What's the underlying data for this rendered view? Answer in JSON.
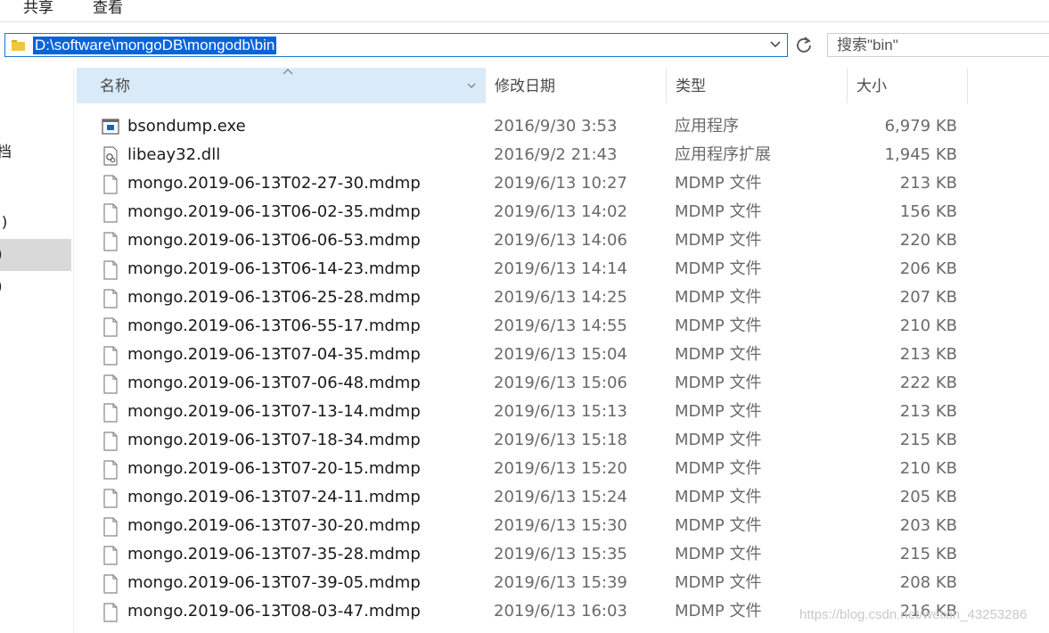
{
  "ribbon": {
    "tabs": [
      "共享",
      "查看"
    ]
  },
  "address": {
    "path": "D:\\software\\mongoDB\\mongodb\\bin",
    "search_placeholder": "搜索\"bin\""
  },
  "nav": {
    "fragments": [
      "档",
      ":)",
      ")",
      ")"
    ]
  },
  "columns": {
    "name": "名称",
    "date": "修改日期",
    "type": "类型",
    "size": "大小"
  },
  "files": [
    {
      "icon": "exe-icon",
      "name": "bsondump.exe",
      "date": "2016/9/30 3:53",
      "type": "应用程序",
      "size": "6,979 KB"
    },
    {
      "icon": "dll-icon",
      "name": "libeay32.dll",
      "date": "2016/9/2 21:43",
      "type": "应用程序扩展",
      "size": "1,945 KB"
    },
    {
      "icon": "file-icon",
      "name": "mongo.2019-06-13T02-27-30.mdmp",
      "date": "2019/6/13 10:27",
      "type": "MDMP 文件",
      "size": "213 KB"
    },
    {
      "icon": "file-icon",
      "name": "mongo.2019-06-13T06-02-35.mdmp",
      "date": "2019/6/13 14:02",
      "type": "MDMP 文件",
      "size": "156 KB"
    },
    {
      "icon": "file-icon",
      "name": "mongo.2019-06-13T06-06-53.mdmp",
      "date": "2019/6/13 14:06",
      "type": "MDMP 文件",
      "size": "220 KB"
    },
    {
      "icon": "file-icon",
      "name": "mongo.2019-06-13T06-14-23.mdmp",
      "date": "2019/6/13 14:14",
      "type": "MDMP 文件",
      "size": "206 KB"
    },
    {
      "icon": "file-icon",
      "name": "mongo.2019-06-13T06-25-28.mdmp",
      "date": "2019/6/13 14:25",
      "type": "MDMP 文件",
      "size": "207 KB"
    },
    {
      "icon": "file-icon",
      "name": "mongo.2019-06-13T06-55-17.mdmp",
      "date": "2019/6/13 14:55",
      "type": "MDMP 文件",
      "size": "210 KB"
    },
    {
      "icon": "file-icon",
      "name": "mongo.2019-06-13T07-04-35.mdmp",
      "date": "2019/6/13 15:04",
      "type": "MDMP 文件",
      "size": "213 KB"
    },
    {
      "icon": "file-icon",
      "name": "mongo.2019-06-13T07-06-48.mdmp",
      "date": "2019/6/13 15:06",
      "type": "MDMP 文件",
      "size": "222 KB"
    },
    {
      "icon": "file-icon",
      "name": "mongo.2019-06-13T07-13-14.mdmp",
      "date": "2019/6/13 15:13",
      "type": "MDMP 文件",
      "size": "213 KB"
    },
    {
      "icon": "file-icon",
      "name": "mongo.2019-06-13T07-18-34.mdmp",
      "date": "2019/6/13 15:18",
      "type": "MDMP 文件",
      "size": "215 KB"
    },
    {
      "icon": "file-icon",
      "name": "mongo.2019-06-13T07-20-15.mdmp",
      "date": "2019/6/13 15:20",
      "type": "MDMP 文件",
      "size": "210 KB"
    },
    {
      "icon": "file-icon",
      "name": "mongo.2019-06-13T07-24-11.mdmp",
      "date": "2019/6/13 15:24",
      "type": "MDMP 文件",
      "size": "205 KB"
    },
    {
      "icon": "file-icon",
      "name": "mongo.2019-06-13T07-30-20.mdmp",
      "date": "2019/6/13 15:30",
      "type": "MDMP 文件",
      "size": "203 KB"
    },
    {
      "icon": "file-icon",
      "name": "mongo.2019-06-13T07-35-28.mdmp",
      "date": "2019/6/13 15:35",
      "type": "MDMP 文件",
      "size": "215 KB"
    },
    {
      "icon": "file-icon",
      "name": "mongo.2019-06-13T07-39-05.mdmp",
      "date": "2019/6/13 15:39",
      "type": "MDMP 文件",
      "size": "208 KB"
    },
    {
      "icon": "file-icon",
      "name": "mongo.2019-06-13T08-03-47.mdmp",
      "date": "2019/6/13 16:03",
      "type": "MDMP 文件",
      "size": "216 KB"
    }
  ],
  "watermark": "https://blog.csdn.net/weixin_43253286"
}
